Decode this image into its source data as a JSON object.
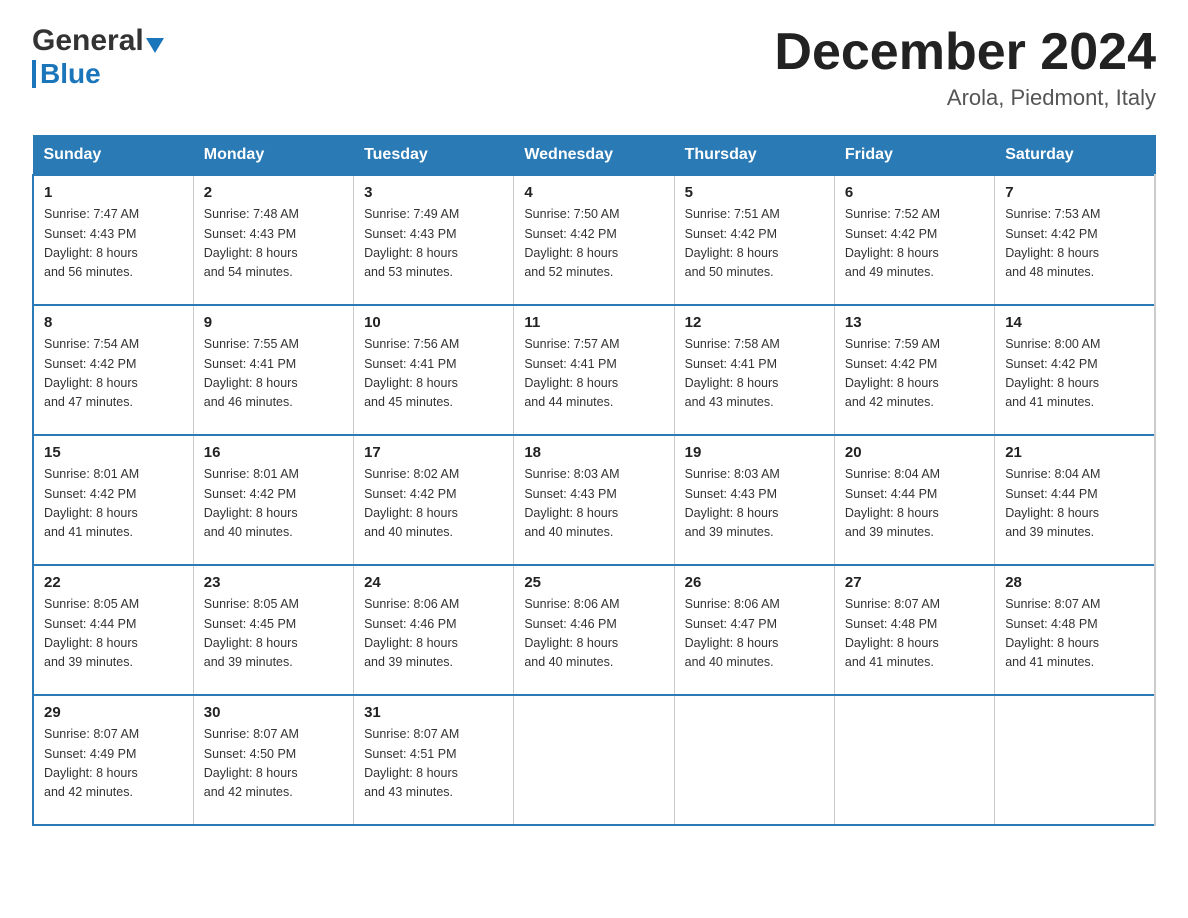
{
  "header": {
    "logo_general": "General",
    "logo_blue": "Blue",
    "title": "December 2024",
    "subtitle": "Arola, Piedmont, Italy"
  },
  "days_of_week": [
    "Sunday",
    "Monday",
    "Tuesday",
    "Wednesday",
    "Thursday",
    "Friday",
    "Saturday"
  ],
  "weeks": [
    [
      {
        "day": "1",
        "sunrise": "7:47 AM",
        "sunset": "4:43 PM",
        "daylight": "8 hours and 56 minutes."
      },
      {
        "day": "2",
        "sunrise": "7:48 AM",
        "sunset": "4:43 PM",
        "daylight": "8 hours and 54 minutes."
      },
      {
        "day": "3",
        "sunrise": "7:49 AM",
        "sunset": "4:43 PM",
        "daylight": "8 hours and 53 minutes."
      },
      {
        "day": "4",
        "sunrise": "7:50 AM",
        "sunset": "4:42 PM",
        "daylight": "8 hours and 52 minutes."
      },
      {
        "day": "5",
        "sunrise": "7:51 AM",
        "sunset": "4:42 PM",
        "daylight": "8 hours and 50 minutes."
      },
      {
        "day": "6",
        "sunrise": "7:52 AM",
        "sunset": "4:42 PM",
        "daylight": "8 hours and 49 minutes."
      },
      {
        "day": "7",
        "sunrise": "7:53 AM",
        "sunset": "4:42 PM",
        "daylight": "8 hours and 48 minutes."
      }
    ],
    [
      {
        "day": "8",
        "sunrise": "7:54 AM",
        "sunset": "4:42 PM",
        "daylight": "8 hours and 47 minutes."
      },
      {
        "day": "9",
        "sunrise": "7:55 AM",
        "sunset": "4:41 PM",
        "daylight": "8 hours and 46 minutes."
      },
      {
        "day": "10",
        "sunrise": "7:56 AM",
        "sunset": "4:41 PM",
        "daylight": "8 hours and 45 minutes."
      },
      {
        "day": "11",
        "sunrise": "7:57 AM",
        "sunset": "4:41 PM",
        "daylight": "8 hours and 44 minutes."
      },
      {
        "day": "12",
        "sunrise": "7:58 AM",
        "sunset": "4:41 PM",
        "daylight": "8 hours and 43 minutes."
      },
      {
        "day": "13",
        "sunrise": "7:59 AM",
        "sunset": "4:42 PM",
        "daylight": "8 hours and 42 minutes."
      },
      {
        "day": "14",
        "sunrise": "8:00 AM",
        "sunset": "4:42 PM",
        "daylight": "8 hours and 41 minutes."
      }
    ],
    [
      {
        "day": "15",
        "sunrise": "8:01 AM",
        "sunset": "4:42 PM",
        "daylight": "8 hours and 41 minutes."
      },
      {
        "day": "16",
        "sunrise": "8:01 AM",
        "sunset": "4:42 PM",
        "daylight": "8 hours and 40 minutes."
      },
      {
        "day": "17",
        "sunrise": "8:02 AM",
        "sunset": "4:42 PM",
        "daylight": "8 hours and 40 minutes."
      },
      {
        "day": "18",
        "sunrise": "8:03 AM",
        "sunset": "4:43 PM",
        "daylight": "8 hours and 40 minutes."
      },
      {
        "day": "19",
        "sunrise": "8:03 AM",
        "sunset": "4:43 PM",
        "daylight": "8 hours and 39 minutes."
      },
      {
        "day": "20",
        "sunrise": "8:04 AM",
        "sunset": "4:44 PM",
        "daylight": "8 hours and 39 minutes."
      },
      {
        "day": "21",
        "sunrise": "8:04 AM",
        "sunset": "4:44 PM",
        "daylight": "8 hours and 39 minutes."
      }
    ],
    [
      {
        "day": "22",
        "sunrise": "8:05 AM",
        "sunset": "4:44 PM",
        "daylight": "8 hours and 39 minutes."
      },
      {
        "day": "23",
        "sunrise": "8:05 AM",
        "sunset": "4:45 PM",
        "daylight": "8 hours and 39 minutes."
      },
      {
        "day": "24",
        "sunrise": "8:06 AM",
        "sunset": "4:46 PM",
        "daylight": "8 hours and 39 minutes."
      },
      {
        "day": "25",
        "sunrise": "8:06 AM",
        "sunset": "4:46 PM",
        "daylight": "8 hours and 40 minutes."
      },
      {
        "day": "26",
        "sunrise": "8:06 AM",
        "sunset": "4:47 PM",
        "daylight": "8 hours and 40 minutes."
      },
      {
        "day": "27",
        "sunrise": "8:07 AM",
        "sunset": "4:48 PM",
        "daylight": "8 hours and 41 minutes."
      },
      {
        "day": "28",
        "sunrise": "8:07 AM",
        "sunset": "4:48 PM",
        "daylight": "8 hours and 41 minutes."
      }
    ],
    [
      {
        "day": "29",
        "sunrise": "8:07 AM",
        "sunset": "4:49 PM",
        "daylight": "8 hours and 42 minutes."
      },
      {
        "day": "30",
        "sunrise": "8:07 AM",
        "sunset": "4:50 PM",
        "daylight": "8 hours and 42 minutes."
      },
      {
        "day": "31",
        "sunrise": "8:07 AM",
        "sunset": "4:51 PM",
        "daylight": "8 hours and 43 minutes."
      },
      null,
      null,
      null,
      null
    ]
  ],
  "labels": {
    "sunrise": "Sunrise:",
    "sunset": "Sunset:",
    "daylight": "Daylight:"
  },
  "colors": {
    "header_bg": "#2a7ab5",
    "header_text": "#ffffff",
    "border_accent": "#2a7ab5"
  }
}
